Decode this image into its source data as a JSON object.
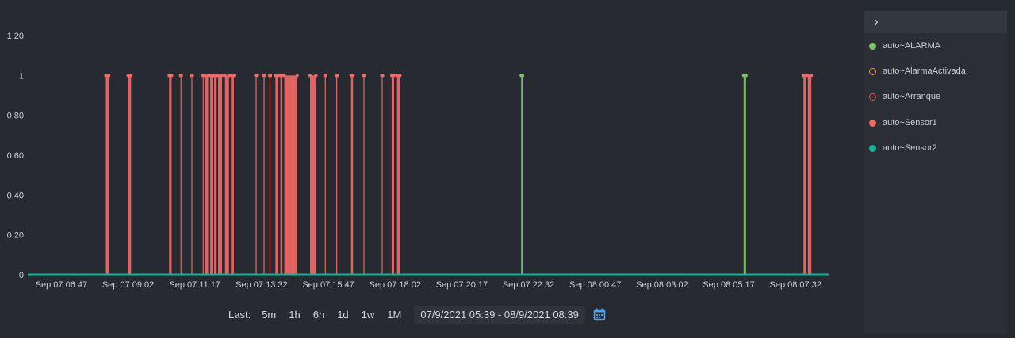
{
  "chart_data": {
    "type": "line",
    "x_start": "Sep 07 05:39",
    "x_end": "Sep 08 08:39",
    "x_ticks": [
      "Sep 07 06:47",
      "Sep 07 09:02",
      "Sep 07 11:17",
      "Sep 07 13:32",
      "Sep 07 15:47",
      "Sep 07 18:02",
      "Sep 07 20:17",
      "Sep 07 22:32",
      "Sep 08 00:47",
      "Sep 08 03:02",
      "Sep 08 05:17",
      "Sep 08 07:32"
    ],
    "y_ticks": [
      "0",
      "0.20",
      "0.40",
      "0.60",
      "0.80",
      "1",
      "1.20"
    ],
    "ylim": [
      0,
      1.2
    ],
    "series": [
      {
        "name": "auto~ALARMA",
        "color": "#7cc36a",
        "style": "filled",
        "pulses": [
          [
            "Sep 07 22:17",
            "Sep 07 22:20"
          ],
          [
            "Sep 08 05:47",
            "Sep 08 05:52"
          ]
        ]
      },
      {
        "name": "auto~AlarmaActivada",
        "color": "#e39a3c",
        "style": "hollow",
        "pulses": []
      },
      {
        "name": "auto~Arranque",
        "color": "#e0514f",
        "style": "hollow",
        "pulses": []
      },
      {
        "name": "auto~Sensor1",
        "color": "#f06a66",
        "style": "filled",
        "pulses": [
          [
            "Sep 07 08:17",
            "Sep 07 08:23"
          ],
          [
            "Sep 07 09:02",
            "Sep 07 09:08"
          ],
          [
            "Sep 07 10:25",
            "Sep 07 10:30"
          ],
          [
            "Sep 07 10:48",
            "Sep 07 10:49"
          ],
          [
            "Sep 07 11:10",
            "Sep 07 11:11"
          ],
          [
            "Sep 07 11:33",
            "Sep 07 11:34"
          ],
          [
            "Sep 07 11:38",
            "Sep 07 11:44"
          ],
          [
            "Sep 07 11:48",
            "Sep 07 11:53"
          ],
          [
            "Sep 07 11:56",
            "Sep 07 12:01"
          ],
          [
            "Sep 07 12:04",
            "Sep 07 12:12"
          ],
          [
            "Sep 07 12:18",
            "Sep 07 12:26"
          ],
          [
            "Sep 07 12:30",
            "Sep 07 12:36"
          ],
          [
            "Sep 07 13:20",
            "Sep 07 13:22"
          ],
          [
            "Sep 07 13:36",
            "Sep 07 13:38"
          ],
          [
            "Sep 07 13:48",
            "Sep 07 13:50"
          ],
          [
            "Sep 07 14:00",
            "Sep 07 14:06"
          ],
          [
            "Sep 07 14:10",
            "Sep 07 14:14"
          ],
          [
            "Sep 07 14:18",
            "Sep 07 14:44"
          ],
          [
            "Sep 07 15:10",
            "Sep 07 15:22"
          ],
          [
            "Sep 07 15:40",
            "Sep 07 15:42"
          ],
          [
            "Sep 07 16:03",
            "Sep 07 16:05"
          ],
          [
            "Sep 07 16:33",
            "Sep 07 16:37"
          ],
          [
            "Sep 07 16:58",
            "Sep 07 17:00"
          ],
          [
            "Sep 07 17:35",
            "Sep 07 17:37"
          ],
          [
            "Sep 07 17:55",
            "Sep 07 18:00"
          ],
          [
            "Sep 07 18:06",
            "Sep 07 18:12"
          ],
          [
            "Sep 08 07:48",
            "Sep 08 07:53"
          ],
          [
            "Sep 08 07:57",
            "Sep 08 08:04"
          ]
        ]
      },
      {
        "name": "auto~Sensor2",
        "color": "#17b095",
        "style": "filled",
        "pulses": []
      }
    ]
  },
  "legend": {
    "items": [
      {
        "label": "auto~ALARMA",
        "color": "#7cc36a",
        "style": "filled"
      },
      {
        "label": "auto~AlarmaActivada",
        "color": "#e39a3c",
        "style": "hollow"
      },
      {
        "label": "auto~Arranque",
        "color": "#e0514f",
        "style": "hollow"
      },
      {
        "label": "auto~Sensor1",
        "color": "#f06a66",
        "style": "filled"
      },
      {
        "label": "auto~Sensor2",
        "color": "#17b095",
        "style": "filled"
      }
    ],
    "toggle_icon": "chevron-right-icon"
  },
  "controls": {
    "last_label": "Last:",
    "ranges": [
      "5m",
      "1h",
      "6h",
      "1d",
      "1w",
      "1M"
    ],
    "date_range": "07/9/2021 05:39 - 08/9/2021 08:39",
    "calendar_icon": "calendar-icon"
  }
}
